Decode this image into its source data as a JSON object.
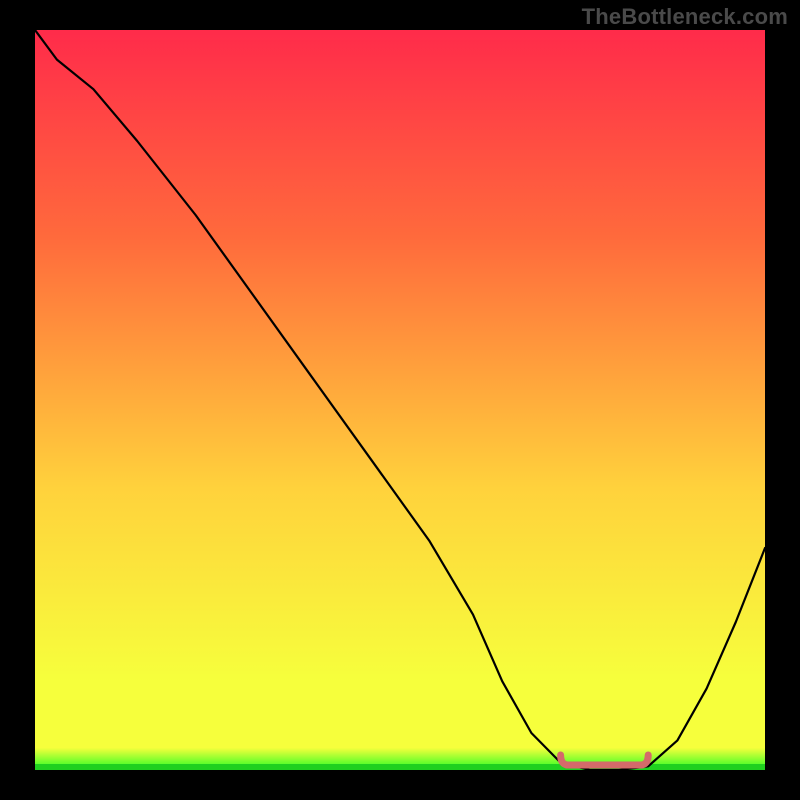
{
  "watermark": "TheBottleneck.com",
  "colors": {
    "background": "#000000",
    "watermark": "#4a4a4a",
    "curve": "#000000",
    "bottom_line": "#1fd11f",
    "bottom_highlight": "#d46a6a",
    "gradient_top": "#ff2b4a",
    "gradient_mid1": "#ff6a3c",
    "gradient_mid2": "#ffd23c",
    "gradient_low": "#f6ff3c",
    "gradient_base": "#24ff24"
  },
  "chart_data": {
    "type": "line",
    "title": "",
    "xlabel": "",
    "ylabel": "",
    "xlim": [
      0,
      100
    ],
    "ylim": [
      0,
      100
    ],
    "x": [
      0,
      3,
      8,
      14,
      22,
      30,
      38,
      46,
      54,
      60,
      64,
      68,
      72,
      76,
      80,
      84,
      88,
      92,
      96,
      100
    ],
    "values": [
      100,
      96,
      92,
      85,
      75,
      64,
      53,
      42,
      31,
      21,
      12,
      5,
      1,
      0,
      0,
      0.5,
      4,
      11,
      20,
      30
    ],
    "flat_segment_x": [
      72,
      84
    ],
    "annotations": []
  }
}
